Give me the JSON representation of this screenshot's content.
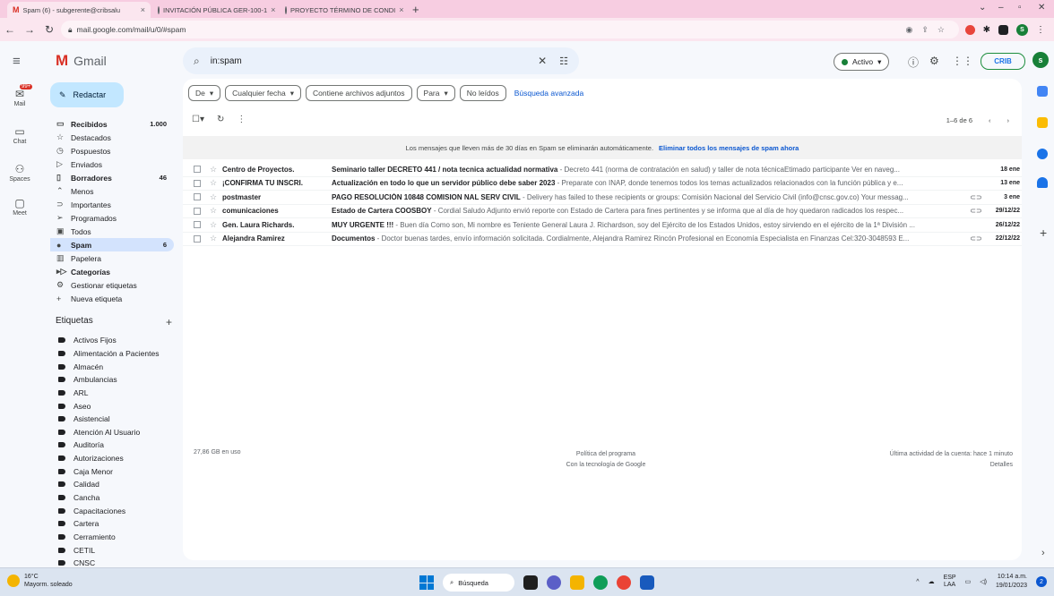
{
  "browser": {
    "tabs": [
      {
        "title": "Spam (6) - subgerente@cribsalu",
        "active": true
      },
      {
        "title": "INVITACIÓN PÚBLICA GER-100-1",
        "active": false
      },
      {
        "title": "PROYECTO TÉRMINO DE CONDI",
        "active": false
      }
    ],
    "url": "mail.google.com/mail/u/0/#spam",
    "profile_initial": "S"
  },
  "header": {
    "app_name": "Gmail",
    "search_value": "in:spam",
    "status": "Activo",
    "org_logo_text": "CRIB",
    "avatar_initial": "s"
  },
  "rail": {
    "items": [
      {
        "label": "Mail",
        "icon": "mail-icon",
        "badge": "99+"
      },
      {
        "label": "Chat",
        "icon": "chat-icon"
      },
      {
        "label": "Spaces",
        "icon": "spaces-icon"
      },
      {
        "label": "Meet",
        "icon": "meet-icon"
      }
    ]
  },
  "compose": {
    "label": "Redactar"
  },
  "nav": {
    "items": [
      {
        "label": "Recibidos",
        "count": "1.000",
        "icon": "inbox-icon",
        "glyph": "▭",
        "style": "bold"
      },
      {
        "label": "Destacados",
        "count": "",
        "icon": "star-icon",
        "glyph": "☆",
        "style": ""
      },
      {
        "label": "Pospuestos",
        "count": "",
        "icon": "clock-icon",
        "glyph": "◷",
        "style": ""
      },
      {
        "label": "Enviados",
        "count": "",
        "icon": "send-icon",
        "glyph": "▷",
        "style": ""
      },
      {
        "label": "Borradores",
        "count": "46",
        "icon": "draft-icon",
        "glyph": "▯",
        "style": "bold"
      },
      {
        "label": "Menos",
        "count": "",
        "icon": "chevron-up-icon",
        "glyph": "⌃",
        "style": ""
      },
      {
        "label": "Importantes",
        "count": "",
        "icon": "important-icon",
        "glyph": "⊃",
        "style": ""
      },
      {
        "label": "Programados",
        "count": "",
        "icon": "scheduled-icon",
        "glyph": "➢",
        "style": ""
      },
      {
        "label": "Todos",
        "count": "",
        "icon": "all-mail-icon",
        "glyph": "▣",
        "style": ""
      },
      {
        "label": "Spam",
        "count": "6",
        "icon": "spam-icon",
        "glyph": "●",
        "style": "sel"
      },
      {
        "label": "Papelera",
        "count": "",
        "icon": "trash-icon",
        "glyph": "▥",
        "style": ""
      },
      {
        "label": "Categorías",
        "count": "",
        "icon": "label-icon",
        "glyph": "▸▷",
        "style": "bold"
      },
      {
        "label": "Gestionar etiquetas",
        "count": "",
        "icon": "gear-icon",
        "glyph": "⚙",
        "style": ""
      },
      {
        "label": "Nueva etiqueta",
        "count": "",
        "icon": "plus-icon",
        "glyph": "+",
        "style": ""
      }
    ]
  },
  "labels": {
    "heading": "Etiquetas",
    "items": [
      "Activos Fijos",
      "Alimentación a Pacientes",
      "Almacén",
      "Ambulancias",
      "ARL",
      "Aseo",
      "Asistencial",
      "Atención Al Usuario",
      "Auditoría",
      "Autorizaciones",
      "Caja Menor",
      "Calidad",
      "Cancha",
      "Capacitaciones",
      "Cartera",
      "Cerramiento",
      "CETIL",
      "CNSC"
    ]
  },
  "filters": {
    "chips": [
      "De",
      "Cualquier fecha",
      "Contiene archivos adjuntos",
      "Para",
      "No leídos"
    ],
    "advanced": "Búsqueda avanzada"
  },
  "toolbar": {
    "pager": "1–6 de 6"
  },
  "banner": {
    "text": "Los mensajes que lleven más de 30 días en Spam se eliminarán automáticamente.",
    "link": "Eliminar todos los mensajes de spam ahora"
  },
  "emails": [
    {
      "sender": "Centro de Proyectos.",
      "subject": "Seminario taller DECRETO 441 / nota tecnica actualidad normativa",
      "snippet": " - Decreto 441 (norma de contratación en salud) y taller de nota técnicaEtimado participante Ver en naveg...",
      "attachment": false,
      "date": "18 ene"
    },
    {
      "sender": "¡CONFIRMA TU INSCRI.",
      "subject": "Actualización en todo lo que un servidor público debe saber 2023",
      "snippet": " - Preparate con INAP, donde tenemos todos los temas actualizados relacionados con la función pública y e...",
      "attachment": false,
      "date": "13 ene"
    },
    {
      "sender": "postmaster",
      "subject": "PAGO RESOLUCIÓN 10848 COMISION NAL SERV CIVIL",
      "snippet": " - Delivery has failed to these recipients or groups: Comisión Nacional del Servicio Civil (info@cnsc.gov.co) Your messag...",
      "attachment": true,
      "date": "3 ene"
    },
    {
      "sender": "comunicaciones",
      "subject": "Estado de Cartera COOSBOY",
      "snippet": " - Cordial Saludo Adjunto envió reporte con Estado de Cartera para fines pertinentes y se informa que al día de hoy quedaron radicados los respec...",
      "attachment": true,
      "date": "29/12/22"
    },
    {
      "sender": "Gen. Laura Richards.",
      "subject": "MUY URGENTE !!!",
      "snippet": " - Buen día Como son, Mi nombre es Teniente General Laura J. Richardson, soy del Ejército de los Estados Unidos, estoy sirviendo en el ejército de la 1ª División ...",
      "attachment": false,
      "date": "26/12/22"
    },
    {
      "sender": "Alejandra Ramirez",
      "subject": "Documentos",
      "snippet": " - Doctor buenas tardes, envío información solicitada. Cordialmente, Alejandra Ramirez Rincón Profesional en Economía Especialista en Finanzas Cel:320-3048593 E...",
      "attachment": true,
      "date": "22/12/22"
    }
  ],
  "footer": {
    "storage": "27,86 GB en uso",
    "policy": "Política del programa",
    "powered": "Con la tecnología de Google",
    "activity": "Última actividad de la cuenta: hace 1 minuto",
    "details": "Detalles"
  },
  "taskbar": {
    "temp": "16°C",
    "weather": "Mayorm. soleado",
    "search": "Búsqueda",
    "lang": "ESP",
    "layout": "LAA",
    "time": "10:14 a.m.",
    "date": "19/01/2023",
    "notif": "2"
  }
}
